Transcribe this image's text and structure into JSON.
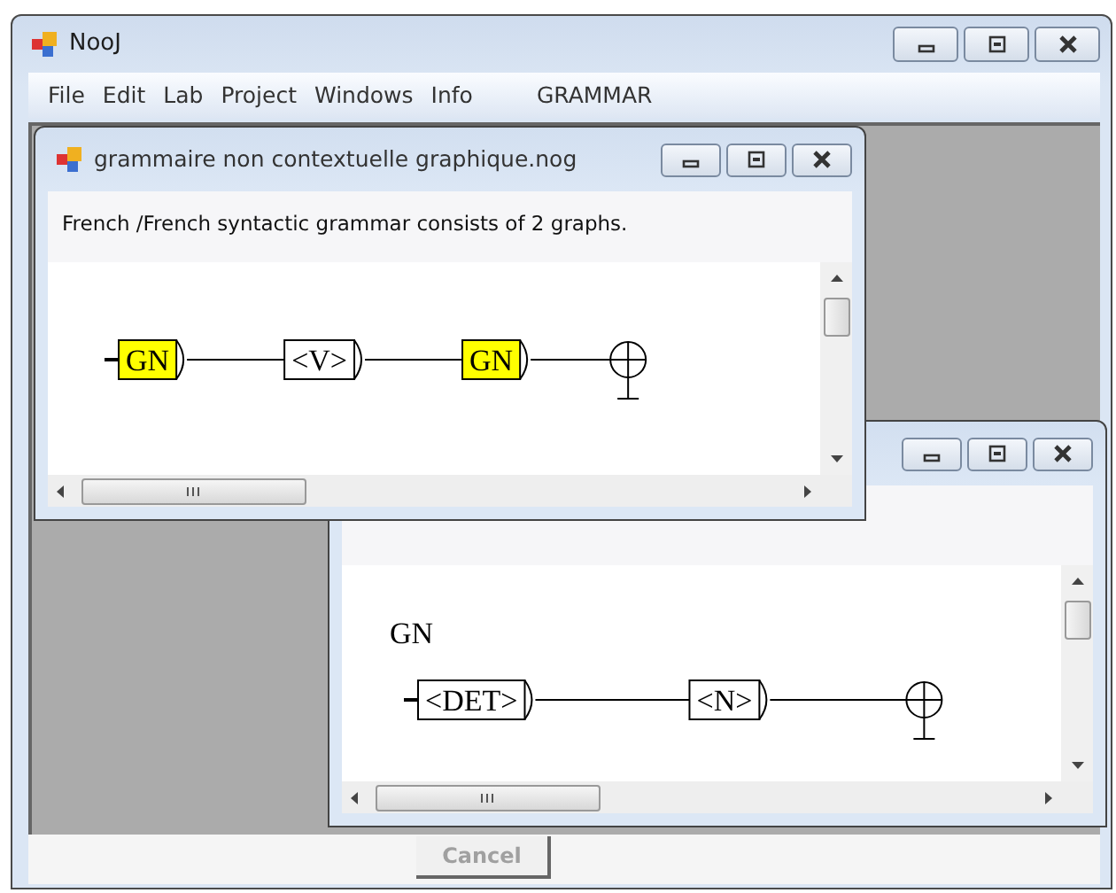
{
  "window": {
    "title": "NooJ"
  },
  "menu": [
    "File",
    "Edit",
    "Lab",
    "Project",
    "Windows",
    "Info"
  ],
  "context_menu": "GRAMMAR",
  "documents": [
    {
      "title": "grammaire non contextuelle graphique.nog",
      "description": "French /French  syntactic grammar consists of 2 graphs.",
      "graph": {
        "nodes": [
          {
            "label": "GN",
            "highlighted": true
          },
          {
            "label": "<V>",
            "highlighted": false
          },
          {
            "label": "GN",
            "highlighted": true
          }
        ]
      }
    },
    {
      "graph": {
        "name": "GN",
        "nodes": [
          {
            "label": "<DET>",
            "highlighted": false
          },
          {
            "label": "<N>",
            "highlighted": false
          }
        ]
      }
    }
  ],
  "cancel_button": {
    "label": "Cancel",
    "disabled": true
  }
}
